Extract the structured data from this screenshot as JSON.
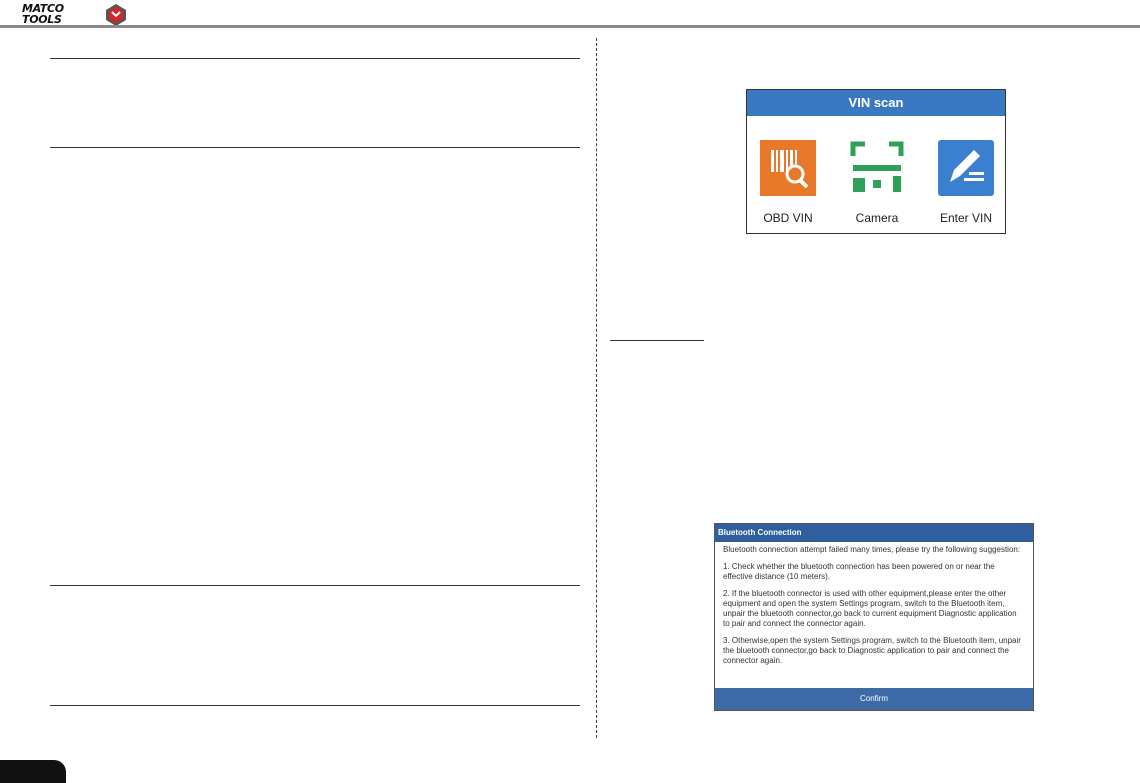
{
  "header": {
    "logo_text_line1": "MATCO",
    "logo_text_line2": "TOOLS"
  },
  "vin_scan": {
    "title": "VIN scan",
    "options": [
      {
        "label": "OBD VIN",
        "icon": "barcode-search-icon",
        "color": "#e8782a"
      },
      {
        "label": "Camera",
        "icon": "camera-scan-icon",
        "color": "#2ea05a"
      },
      {
        "label": "Enter VIN",
        "icon": "pen-entry-icon",
        "color": "#3b7fd0"
      }
    ],
    "header_color": "#3b78c4"
  },
  "bluetooth": {
    "title": "Bluetooth Connection",
    "intro": "Bluetooth connection attempt failed many times, please try the following suggestion:",
    "step1": "1. Check whether the bluetooth connection has been powered on or near the effective distance (10 meters).",
    "step2": "2. If the bluetooth connector is used with other equipment,please enter the other equipment and open the system Settings program, switch to the Bluetooth item, unpair the bluetooth connector,go back to current equipment Diagnostic application to pair and connect the connector again.",
    "step3": "3. Otherwise,open the system Settings program, switch to the Bluetooth item, unpair the bluetooth connector,go back to Diagnostic application to pair and connect the connector again.",
    "confirm_label": "Confirm",
    "header_color": "#2f5f9e"
  }
}
